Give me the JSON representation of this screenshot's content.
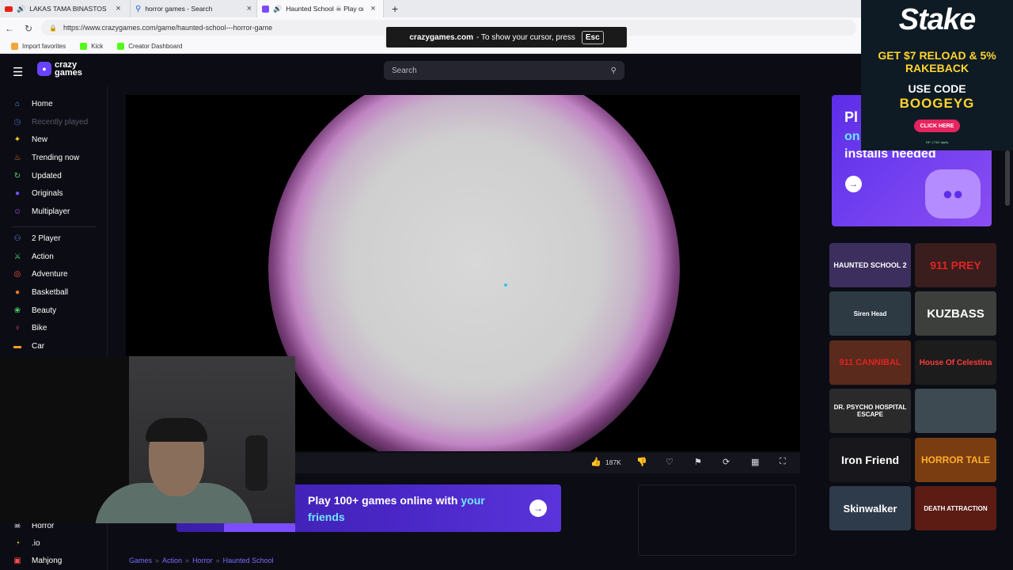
{
  "browser": {
    "tabs": [
      {
        "title": "LAKAS TAMA BINASTOS SI A",
        "favicon": "youtube-icon",
        "active": false
      },
      {
        "title": "horror games - Search",
        "favicon": "search-icon",
        "active": false
      },
      {
        "title": "Haunted School",
        "favicon": "crazygames-icon",
        "active": true
      }
    ],
    "active_tab_suffix": "Play on",
    "url": "https://www.crazygames.com/game/haunted-school---horror-game",
    "bookmarks": [
      {
        "label": "Import favorites",
        "color": "#f2a53a"
      },
      {
        "label": "Kick",
        "color": "#53fc18"
      },
      {
        "label": "Creator Dashboard",
        "color": "#53fc18"
      }
    ],
    "fullscreen_notice": {
      "domain": "crazygames.com",
      "message": "- To show your cursor, press",
      "key": "Esc"
    }
  },
  "site": {
    "logo_top": "crazy",
    "logo_bottom": "games",
    "search_placeholder": "Search",
    "sidebar": [
      {
        "label": "Home",
        "icon": "home-icon",
        "color": "#6c8cff",
        "dim": false
      },
      {
        "label": "Recently played",
        "icon": "clock-icon",
        "color": "#4a5fd0",
        "dim": true
      },
      {
        "label": "New",
        "icon": "sparkle-icon",
        "color": "#ffd530",
        "dim": false
      },
      {
        "label": "Trending now",
        "icon": "flame-icon",
        "color": "#ff7a2a",
        "dim": false
      },
      {
        "label": "Updated",
        "icon": "refresh-icon",
        "color": "#4ad66d",
        "dim": false
      },
      {
        "label": "Originals",
        "icon": "crazygames-icon",
        "color": "#7c4dff",
        "dim": false
      },
      {
        "label": "Multiplayer",
        "icon": "multiplayer-icon",
        "color": "#b54cff",
        "dim": false
      },
      {
        "label": "2 Player",
        "icon": "two-player-icon",
        "color": "#6c8cff",
        "dim": false
      },
      {
        "label": "Action",
        "icon": "sword-icon",
        "color": "#4ad66d",
        "dim": false
      },
      {
        "label": "Adventure",
        "icon": "compass-icon",
        "color": "#ff4d4d",
        "dim": false
      },
      {
        "label": "Basketball",
        "icon": "basketball-icon",
        "color": "#ff7a2a",
        "dim": false
      },
      {
        "label": "Beauty",
        "icon": "beauty-icon",
        "color": "#4ad66d",
        "dim": false
      },
      {
        "label": "Bike",
        "icon": "bike-icon",
        "color": "#ff4d7a",
        "dim": false
      },
      {
        "label": "Car",
        "icon": "car-icon",
        "color": "#ff9a2a",
        "dim": false
      }
    ],
    "sidebar_bottom": [
      {
        "label": "Horror",
        "icon": "ghost-icon",
        "color": "#ffffff"
      },
      {
        "label": ".io",
        "icon": "io-icon",
        "color": "#ffd530"
      },
      {
        "label": "Mahjong",
        "icon": "mahjong-icon",
        "color": "#ff4d4d"
      }
    ],
    "toolbar": {
      "like_count": "187K"
    },
    "promo": {
      "line1": "Play 100+ games online with ",
      "accent": "your",
      "line2": "friends"
    },
    "breadcrumb": [
      "Games",
      "Action",
      "Horror",
      "Haunted School"
    ],
    "ad": {
      "line1": "Pl",
      "line2": "on",
      "line3": "installs needed"
    },
    "thumbnails": [
      {
        "label": "HAUNTED SCHOOL 2",
        "bg": "#3c2f5e",
        "fg": "#ffffff",
        "size": 9
      },
      {
        "label": "911 PREY",
        "bg": "#3a1d1d",
        "fg": "#e02424",
        "size": 14
      },
      {
        "label": "Siren Head",
        "bg": "#2d3a44",
        "fg": "#ffffff",
        "size": 8
      },
      {
        "label": "KUZBASS",
        "bg": "#3c3f3c",
        "fg": "#ffffff",
        "size": 15
      },
      {
        "label": "911 CANNIBAL",
        "bg": "#5a2a1c",
        "fg": "#e02424",
        "size": 11
      },
      {
        "label": "House Of Celestina",
        "bg": "#1c1c1c",
        "fg": "#ff3b3b",
        "size": 10
      },
      {
        "label": "DR. PSYCHO HOSPITAL ESCAPE",
        "bg": "#2a2a2a",
        "fg": "#ffffff",
        "size": 8
      },
      {
        "label": "",
        "bg": "#3e4a52",
        "fg": "#ffffff",
        "size": 8
      },
      {
        "label": "Iron Friend",
        "bg": "#17171c",
        "fg": "#ffffff",
        "size": 14
      },
      {
        "label": "HORROR TALE",
        "bg": "#7a3d12",
        "fg": "#ffb02a",
        "size": 12
      },
      {
        "label": "Skinwalker",
        "bg": "#2e3b4a",
        "fg": "#ffffff",
        "size": 13
      },
      {
        "label": "DEATH ATTRACTION",
        "bg": "#5c1c14",
        "fg": "#ffffff",
        "size": 8
      }
    ]
  },
  "stake_ad": {
    "logo": "Stake",
    "offer": "GET $7 RELOAD & 5% RAKEBACK",
    "use": "USE CODE",
    "code": "BOOGEYG",
    "button": "CLICK HERE",
    "fine": "18+ | T&C apply"
  }
}
